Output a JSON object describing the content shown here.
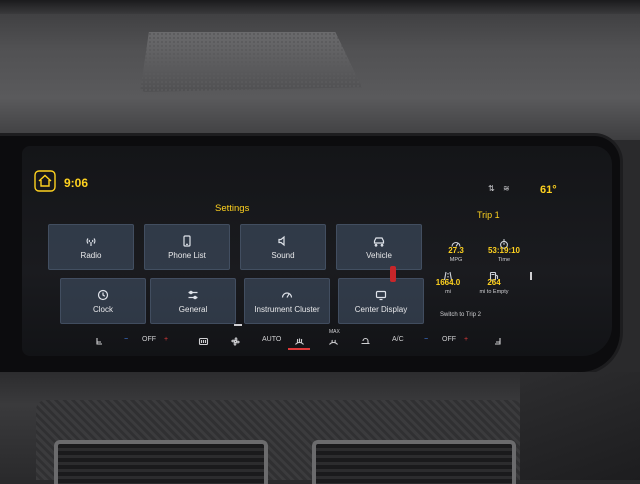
{
  "header": {
    "time": "9:06",
    "title": "Settings",
    "temperature": "61°"
  },
  "tiles": [
    {
      "label": "Radio",
      "icon": "radio-icon"
    },
    {
      "label": "Phone List",
      "icon": "phone-icon"
    },
    {
      "label": "Sound",
      "icon": "speaker-icon"
    },
    {
      "label": "Vehicle",
      "icon": "car-icon"
    },
    {
      "label": "Clock",
      "icon": "clock-icon"
    },
    {
      "label": "General",
      "icon": "sliders-icon"
    },
    {
      "label": "Instrument Cluster",
      "icon": "gauge-icon"
    },
    {
      "label": "Center Display",
      "icon": "display-icon"
    }
  ],
  "climate": {
    "left_fan": "OFF",
    "mode": "AUTO",
    "max_label": "MAX",
    "ac": "A/C",
    "right_fan": "OFF",
    "minus": "−",
    "plus": "+"
  },
  "trip": {
    "title": "Trip 1",
    "stats": [
      {
        "value": "27.3",
        "label": "MPG",
        "icon": "fuel-gauge-icon"
      },
      {
        "value": "53:19:10",
        "label": "Time",
        "icon": "stopwatch-icon"
      },
      {
        "value": "1664.0",
        "label": "mi",
        "icon": "road-icon"
      },
      {
        "value": "264",
        "label": "mi to Empty",
        "icon": "fuel-pump-icon"
      }
    ],
    "switch_label": "Switch to Trip 2"
  },
  "colors": {
    "accent": "#ffd21f",
    "tile": "#46566c",
    "alert_red": "#e03a3a"
  }
}
